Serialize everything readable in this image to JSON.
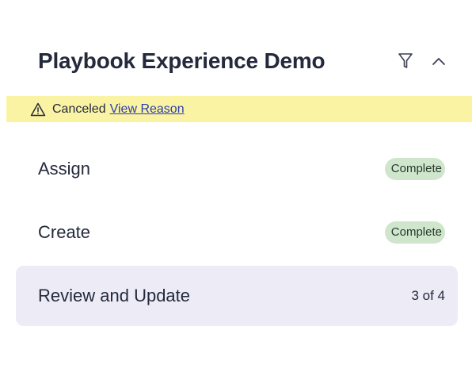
{
  "header": {
    "title": "Playbook Experience Demo"
  },
  "icons": {
    "filter": "filter-icon",
    "collapse": "chevron-up-icon",
    "warning": "warning-triangle-icon"
  },
  "banner": {
    "status": "Canceled",
    "link": "View Reason",
    "background_color": "#fbf3a4",
    "link_color": "#2c3fa8"
  },
  "steps": [
    {
      "label": "Assign",
      "status": "Complete"
    },
    {
      "label": "Create",
      "status": "Complete"
    },
    {
      "label": "Review and Update",
      "progress": "3 of 4"
    }
  ],
  "colors": {
    "complete_badge": "#cfe6cc",
    "active_row": "#ecebf6"
  }
}
